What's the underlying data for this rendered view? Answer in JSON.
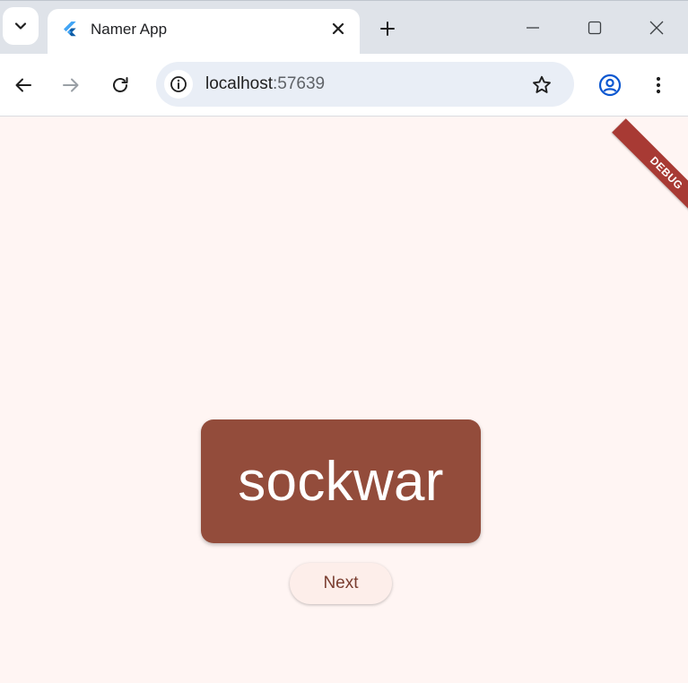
{
  "browser": {
    "tab": {
      "title": "Namer App",
      "favicon": "flutter-logo-icon"
    },
    "new_tab_icon": "plus-icon",
    "window_controls": [
      "minimize-icon",
      "maximize-icon",
      "close-icon"
    ],
    "address": {
      "host": "localhost",
      "port": ":57639"
    },
    "colors": {
      "tab_strip": "#dfe3e9",
      "omnibox": "#e9eef6",
      "profile": "#0b57d0"
    }
  },
  "app": {
    "debug_banner": "DEBUG",
    "word_pair": "sockwar",
    "next_label": "Next",
    "colors": {
      "background": "#fff5f3",
      "card": "#934c3b",
      "card_text": "#ffffff",
      "button_bg": "#fdeeea",
      "button_text": "#7a3d30"
    }
  }
}
